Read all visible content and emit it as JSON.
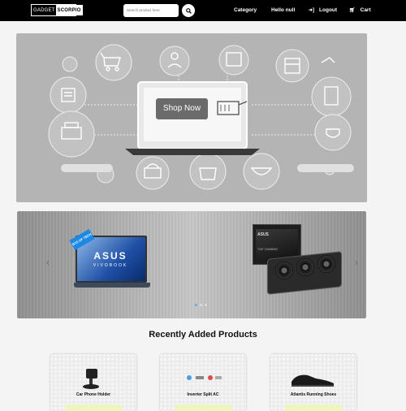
{
  "nav": {
    "logo_left": "GADGET",
    "logo_right": "SCORPIO",
    "search_placeholder": "Search product here",
    "category_label": "Category",
    "hello_label": "Hello null",
    "logout_label": "Logout",
    "cart_label": "Cart"
  },
  "hero": {
    "button_label": "Shop Now"
  },
  "carousel": {
    "laptop_brand": "ASUS",
    "laptop_model": "VIVOBOOK",
    "laptop_badge": "BTS OF TECH",
    "gpu_brand": "ASUS",
    "gpu_label": "TUF GAMING",
    "slide_count": 3,
    "active_slide": 1
  },
  "products": {
    "title": "Recently Added Products",
    "items": [
      {
        "name": "Car Phone Holder"
      },
      {
        "name": "Inverter Split AC"
      },
      {
        "name": "Atlantis Running Shoes"
      }
    ]
  },
  "colors": {
    "nav_bg": "#000000",
    "hero_bg": "#b4b4b4",
    "accent_dot": "#6aa8d8"
  }
}
